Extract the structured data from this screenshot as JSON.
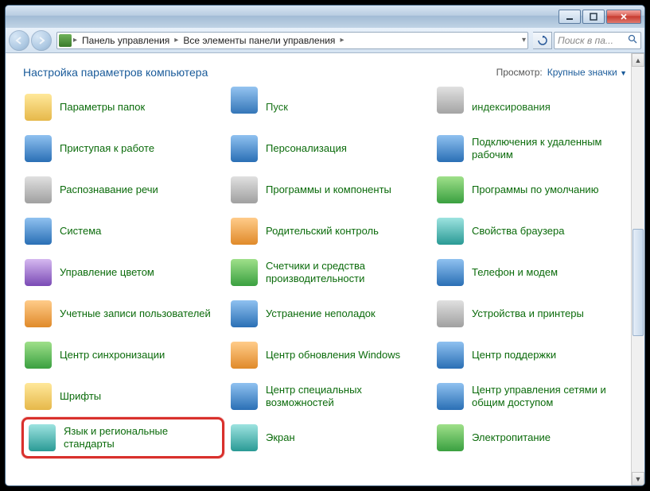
{
  "titlebar": {
    "minimize_icon": "minimize-icon",
    "maximize_icon": "maximize-icon",
    "close_icon": "close-icon"
  },
  "breadcrumb": {
    "root": "Панель управления",
    "sub": "Все элементы панели управления"
  },
  "search": {
    "placeholder": "Поиск в па..."
  },
  "header": {
    "title": "Настройка параметров компьютера",
    "viewby_label": "Просмотр:",
    "viewby_value": "Крупные значки"
  },
  "items": [
    {
      "label": "Параметры папок",
      "icon": "folder-options-icon",
      "cls": "ic-yellow"
    },
    {
      "label": "Пуск",
      "icon": "start-icon",
      "cls": "ic-blue",
      "cut": true
    },
    {
      "label": "индексирования",
      "icon": "indexing-icon",
      "cls": "ic-gray",
      "cut": true
    },
    {
      "label": "Приступая к работе",
      "icon": "getting-started-icon",
      "cls": "ic-blue"
    },
    {
      "label": "Персонализация",
      "icon": "personalization-icon",
      "cls": "ic-blue"
    },
    {
      "label": "Подключения к удаленным рабочим",
      "icon": "remote-desktop-icon",
      "cls": "ic-blue"
    },
    {
      "label": "Распознавание речи",
      "icon": "speech-icon",
      "cls": "ic-gray"
    },
    {
      "label": "Программы и компоненты",
      "icon": "programs-icon",
      "cls": "ic-gray"
    },
    {
      "label": "Программы по умолчанию",
      "icon": "default-programs-icon",
      "cls": "ic-green"
    },
    {
      "label": "Система",
      "icon": "system-icon",
      "cls": "ic-blue"
    },
    {
      "label": "Родительский контроль",
      "icon": "parental-icon",
      "cls": "ic-orange"
    },
    {
      "label": "Свойства браузера",
      "icon": "internet-options-icon",
      "cls": "ic-teal"
    },
    {
      "label": "Управление цветом",
      "icon": "color-mgmt-icon",
      "cls": "ic-purple"
    },
    {
      "label": "Счетчики и средства производительности",
      "icon": "performance-icon",
      "cls": "ic-green"
    },
    {
      "label": "Телефон и модем",
      "icon": "phone-modem-icon",
      "cls": "ic-blue"
    },
    {
      "label": "Учетные записи пользователей",
      "icon": "user-accounts-icon",
      "cls": "ic-orange"
    },
    {
      "label": "Устранение неполадок",
      "icon": "troubleshoot-icon",
      "cls": "ic-blue"
    },
    {
      "label": "Устройства и принтеры",
      "icon": "devices-printers-icon",
      "cls": "ic-gray"
    },
    {
      "label": "Центр синхронизации",
      "icon": "sync-center-icon",
      "cls": "ic-green"
    },
    {
      "label": "Центр обновления Windows",
      "icon": "windows-update-icon",
      "cls": "ic-orange"
    },
    {
      "label": "Центр поддержки",
      "icon": "action-center-icon",
      "cls": "ic-blue"
    },
    {
      "label": "Шрифты",
      "icon": "fonts-icon",
      "cls": "ic-yellow"
    },
    {
      "label": "Центр специальных возможностей",
      "icon": "ease-of-access-icon",
      "cls": "ic-blue"
    },
    {
      "label": "Центр управления сетями и общим доступом",
      "icon": "network-sharing-icon",
      "cls": "ic-blue"
    },
    {
      "label": "Язык и региональные стандарты",
      "icon": "region-language-icon",
      "cls": "ic-teal",
      "highlighted": true
    },
    {
      "label": "Экран",
      "icon": "display-icon",
      "cls": "ic-teal"
    },
    {
      "label": "Электропитание",
      "icon": "power-options-icon",
      "cls": "ic-green"
    }
  ]
}
